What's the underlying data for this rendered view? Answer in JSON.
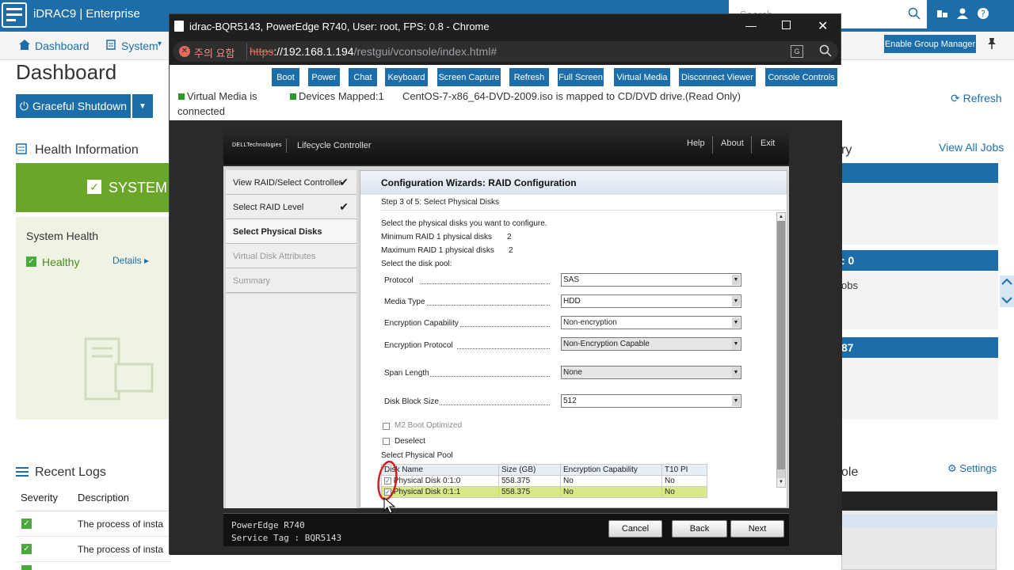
{
  "app": {
    "brand": "iDRAC9",
    "edition": "Enterprise",
    "search_placeholder": "Search"
  },
  "nav": {
    "dashboard": "Dashboard",
    "system": "System",
    "group_manager": "Enable Group Manager"
  },
  "page": {
    "title": "Dashboard",
    "graceful_shutdown": "Graceful Shutdown",
    "refresh": "Refresh"
  },
  "health": {
    "title": "Health Information",
    "system_banner": "SYSTEM",
    "system_health": "System Health",
    "status": "Healthy",
    "details": "Details"
  },
  "jobs": {
    "title_fragment": "ry",
    "view_all": "View All Jobs",
    "count1": ": 0",
    "jobs_label": "obs",
    "count2": " 87"
  },
  "logs": {
    "title": "Recent Logs",
    "settings": "Settings",
    "col_severity": "Severity",
    "col_description": "Description",
    "rows": [
      {
        "description": "The process of insta"
      },
      {
        "description": "The process of insta"
      }
    ]
  },
  "virtual_console_fragment": "ole",
  "chrome": {
    "title": "idrac-BQR5143, PowerEdge R740, User: root, FPS: 0.8 - Chrome",
    "security_warning": "주의 요함",
    "url_scheme": "https",
    "url_host": "://192.168.1.194",
    "url_path": "/restgui/vconsole/index.html#"
  },
  "console_toolbar": {
    "buttons": [
      "Boot",
      "Power",
      "Chat",
      "Keyboard",
      "Screen Capture",
      "Refresh",
      "Full Screen",
      "Virtual Media",
      "Disconnect Viewer",
      "Console Controls"
    ],
    "status_vm": "Virtual Media is",
    "status_vm2": "connected",
    "status_devices": "Devices Mapped:1",
    "status_iso": "CentOS-7-x86_64-DVD-2009.iso is mapped to CD/DVD drive.(Read Only)"
  },
  "lc": {
    "brand": "DELLTechnologies",
    "product": "Lifecycle Controller",
    "menu": [
      "Help",
      "About",
      "Exit"
    ],
    "steps": [
      {
        "label": "View RAID/Select Controller",
        "done": true
      },
      {
        "label": "Select RAID Level",
        "done": true
      },
      {
        "label": "Select Physical Disks",
        "current": true
      },
      {
        "label": "Virtual Disk Attributes",
        "disabled": true
      },
      {
        "label": "Summary",
        "disabled": true
      }
    ],
    "heading": "Configuration Wizards: RAID Configuration",
    "step_label": "Step 3 of 5: Select Physical Disks",
    "intro": "Select the physical disks you want to configure.",
    "min_label": "Minimum RAID 1 physical disks",
    "min_value": "2",
    "max_label": "Maximum RAID 1 physical disks",
    "max_value": "2",
    "pool_label": "Select the disk pool:",
    "fields": [
      {
        "label": "Protocol",
        "value": "SAS"
      },
      {
        "label": "Media Type",
        "value": "HDD"
      },
      {
        "label": "Encryption Capability",
        "value": "Non-encryption"
      },
      {
        "label": "Encryption Protocol",
        "value": "Non-Encryption Capable"
      },
      {
        "label": "Span Length",
        "value": "None"
      },
      {
        "label": "Disk Block Size",
        "value": "512"
      }
    ],
    "m2_boot": "M2 Boot Optimized",
    "deselect": "Deselect",
    "phys_pool": "Select Physical Pool",
    "table": {
      "headers": [
        "Disk Name",
        "Size (GB)",
        "Encryption Capability",
        "T10 PI"
      ],
      "rows": [
        {
          "name": "Physical Disk 0:1:0",
          "size": "558.375",
          "enc": "No",
          "t10": "No",
          "checked": true
        },
        {
          "name": "Physical Disk 0:1:1",
          "size": "558.375",
          "enc": "No",
          "t10": "No",
          "checked": true
        }
      ]
    },
    "footer_model": "PowerEdge R740",
    "footer_tag": "Service Tag : BQR5143",
    "buttons": {
      "cancel": "Cancel",
      "back": "Back",
      "next": "Next"
    }
  },
  "colors": {
    "accent": "#1d6ea8",
    "healthy": "#6aa62a",
    "row_highlight": "#d9e98a"
  }
}
